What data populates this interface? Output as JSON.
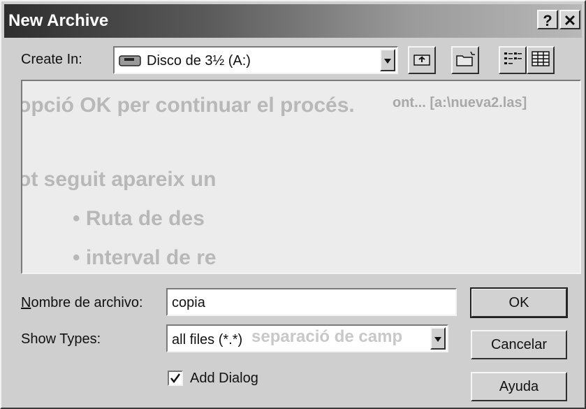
{
  "window": {
    "title": "New Archive",
    "help_glyph": "?",
    "close_glyph": "✕"
  },
  "create_in": {
    "label": "Create In:",
    "value": "Disco de 3½ (A:)",
    "icon": "floppy-drive-icon"
  },
  "toolbar": {
    "up_icon": "up-one-level-icon",
    "new_folder_icon": "new-folder-icon",
    "list_icon": "list-view-icon",
    "details_icon": "details-view-icon"
  },
  "background_text": {
    "line1": "opció OK per continuar el procés.",
    "line2": "ont... [a:\\nueva2.las]",
    "line3": "ot seguit apareix un",
    "bullet1": "• Ruta de des",
    "bullet2": "• interval de re",
    "line4": "separació de camp"
  },
  "filename": {
    "label": "Nombre de archivo:",
    "value": "copia"
  },
  "types": {
    "label": "Show Types:",
    "value": "all files (*.*)"
  },
  "add_dialog": {
    "label": "Add Dialog",
    "checked": true
  },
  "buttons": {
    "ok": "OK",
    "cancel": "Cancelar",
    "help": "Ayuda"
  },
  "colors": {
    "titlebar_dark": "#2e2e2e",
    "face": "#cfcfcf"
  }
}
